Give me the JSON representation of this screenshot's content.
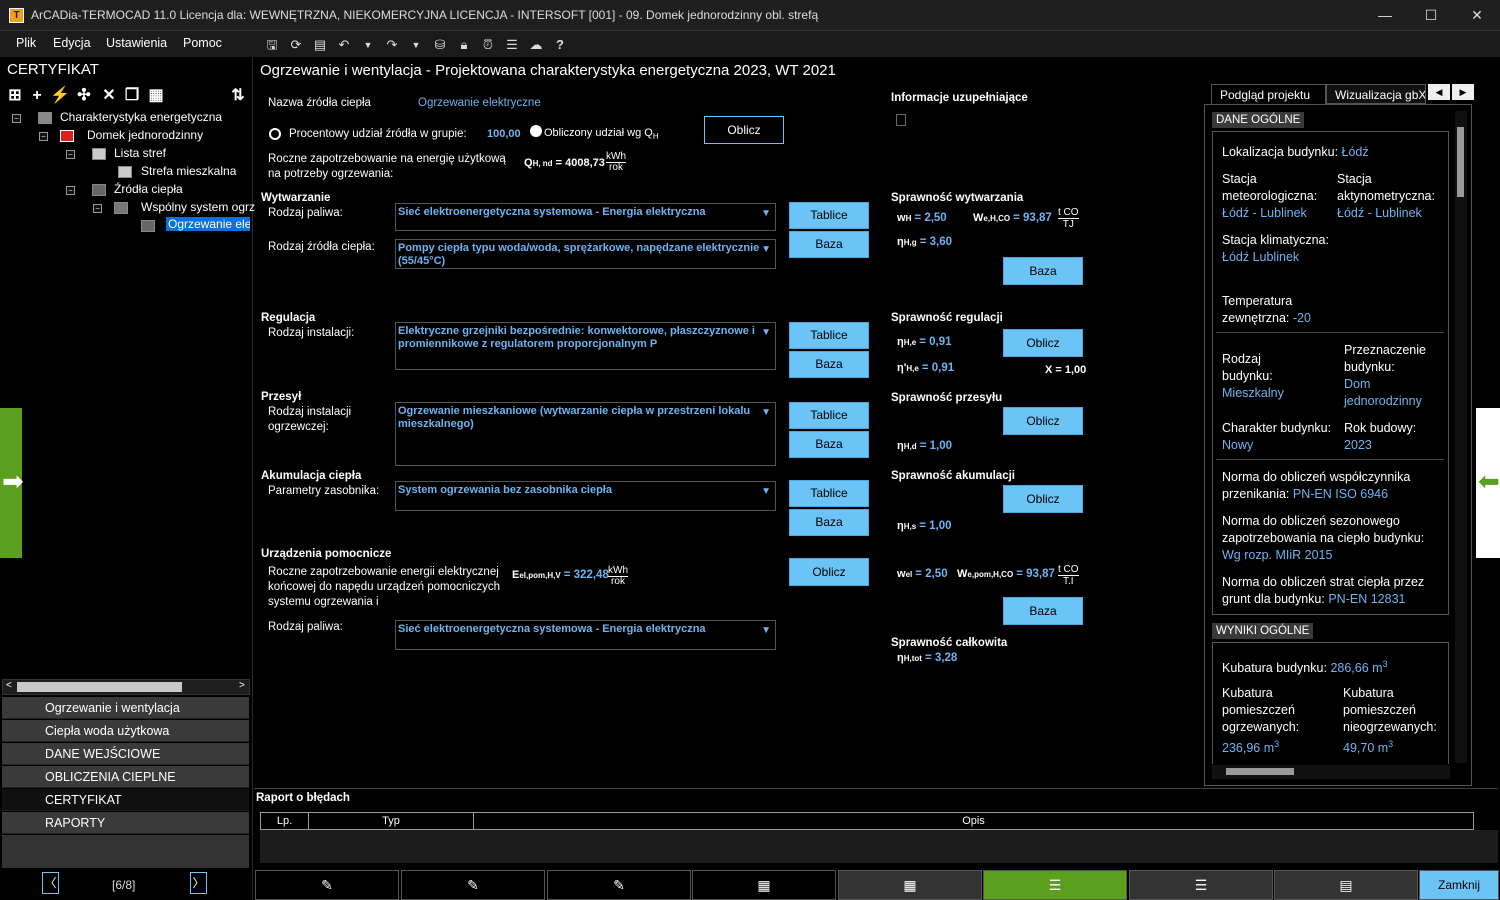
{
  "window": {
    "title": "ArCADia-TERMOCAD 11.0 Licencja dla: WEWNĘTRZNA, NIEKOMERCYJNA LICENCJA - INTERSOFT [001] - 09. Domek jednorodzinny obl. strefą",
    "app_icon": "T",
    "min": "—",
    "max": "☐",
    "close": "✕"
  },
  "menu": {
    "file": "Plik",
    "edit": "Edycja",
    "settings": "Ustawienia",
    "help": "Pomoc"
  },
  "toolbar_icons": [
    "save-icon",
    "refresh-icon",
    "preview-icon",
    "undo-icon",
    "undo-dropdown-icon",
    "redo-icon",
    "redo-dropdown-icon",
    "library-icon",
    "lock-icon",
    "alarm-icon",
    "notes-icon",
    "cloud-icon",
    "help-icon"
  ],
  "left": {
    "title": "CERTYFIKAT",
    "tree": {
      "root": "Charakterystyka energetyczna",
      "building": "Domek jednorodzinny",
      "zones": "Lista stref",
      "zone1": "Strefa mieszkalna",
      "sources": "Źródła ciepła",
      "common": "Wspólny system ogrz",
      "heating": "Ogrzewanie elektryczne"
    },
    "nav": [
      "Ogrzewanie i wentylacja",
      "Ciepła woda użytkowa",
      "DANE WEJŚCIOWE",
      "OBLICZENIA CIEPLNE",
      "CERTYFIKAT",
      "RAPORTY"
    ],
    "pager": "[6/8]",
    "prev": "〈",
    "next": "〉"
  },
  "main": {
    "heading": "Ogrzewanie i wentylacja - Projektowana charakterystyka energetyczna 2023, WT 2021",
    "source_name_label": "Nazwa źródła ciepła",
    "source_name": "Ogrzewanie elektryczne",
    "percent_label": "Procentowy udział źródła w grupie:",
    "percent_value": "100,00",
    "calc_share_label": "Obliczony udział wg Q",
    "calc_share_sub": "H",
    "calc_btn": "Oblicz",
    "annual_label": "Roczne zapotrzebowanie na energię użytkową na potrzeby ogrzewania:",
    "qhnd_label": "Q",
    "qhnd_sub": "H, nd",
    "qhnd_value": "= 4008,73",
    "unit_kwh": "kWh",
    "unit_rok": "rok",
    "info_label": "Informacje uzupełniające",
    "gen": {
      "title": "Wytwarzanie",
      "fuel_label": "Rodzaj paliwa:",
      "fuel": "Sieć elektroenergetyczna systemowa - Energia elektryczna",
      "source_label": "Rodzaj źródła ciepła:",
      "source": "Pompy ciepła typu woda/woda, sprężarkowe, napędzane elektrycznie (55/45°C)",
      "tab": "Tablice",
      "base": "Baza"
    },
    "eff_gen": {
      "title": "Sprawność wytwarzania",
      "wh": "w",
      "wh_sub": "H",
      "wh_val": "= 2,50",
      "weh": "W",
      "weh_sub": "e,H,CO",
      "weh_val": "= 93,87",
      "unit_top": "t CO",
      "unit_bot": "TJ",
      "eta": "η",
      "eta_sub": "H,g",
      "eta_val": "= 3,60",
      "base": "Baza"
    },
    "reg": {
      "title": "Regulacja",
      "inst_label": "Rodzaj instalacji:",
      "inst": "Elektryczne grzejniki bezpośrednie: konwektorowe, płaszczyznowe i promiennikowe z regulatorem proporcjonalnym P",
      "tab": "Tablice",
      "base": "Baza"
    },
    "eff_reg": {
      "title": "Sprawność regulacji",
      "eta": "η",
      "eta_sub": "H,e",
      "eta_val": "= 0,91",
      "eta2": "η'",
      "eta2_sub": "H,e",
      "eta2_val": "= 0,91",
      "x": "X = 1,00",
      "calc": "Oblicz"
    },
    "dist": {
      "title": "Przesył",
      "inst_label": "Rodzaj instalacji ogrzewczej:",
      "inst": "Ogrzewanie mieszkaniowe (wytwarzanie ciepła w przestrzeni lokalu mieszkalnego)",
      "tab": "Tablice",
      "base": "Baza"
    },
    "eff_dist": {
      "title": "Sprawność przesyłu",
      "eta": "η",
      "eta_sub": "H,d",
      "eta_val": "= 1,00",
      "calc": "Oblicz"
    },
    "acc": {
      "title": "Akumulacja ciepła",
      "param_label": "Parametry zasobnika:",
      "param": "System ogrzewania bez zasobnika ciepła",
      "tab": "Tablice",
      "base": "Baza"
    },
    "eff_acc": {
      "title": "Sprawność akumulacji",
      "eta": "η",
      "eta_sub": "H,s",
      "eta_val": "= 1,00",
      "calc": "Oblicz"
    },
    "aux": {
      "title": "Urządzenia pomocnicze",
      "desc": "Roczne zapotrzebowanie energii elektrycznej końcowej do napędu urządzeń pomocniczych systemu ogrzewania i",
      "e_label": "E",
      "e_sub": "el,pom,H,V",
      "e_val": "= 322,48",
      "calc": "Oblicz",
      "fuel_label": "Rodzaj paliwa:",
      "fuel": "Sieć elektroenergetyczna systemowa - Energia elektryczna"
    },
    "eff_aux": {
      "wel": "w",
      "wel_sub": "el",
      "wel_val": "= 2,50",
      "w2": "W",
      "w2_sub": "e,pom,H,CO",
      "w2_val": "= 93,87",
      "unit_top": "t CO",
      "unit_bot": "T.I",
      "base": "Baza"
    },
    "total": {
      "title": "Sprawność całkowita",
      "eta": "η",
      "eta_sub": "H,tot",
      "eta_val": "= 3,28"
    }
  },
  "right": {
    "tab1": "Podgląd projektu",
    "tab2": "Wizualizacja gbXML",
    "general": "DANE OGÓLNE",
    "loc_label": "Lokalizacja budynku:",
    "loc": "Łódź",
    "meteo_label": "Stacja meteorologiczna:",
    "meteo": "Łódź - Lublinek",
    "act_label": "Stacja aktynometryczna:",
    "act": "Łódź - Lublinek",
    "clim_label": "Stacja klimatyczna:",
    "clim": "Łódź Lublinek",
    "temp_label": "Temperatura zewnętrzna:",
    "temp": "-20",
    "type_label": "Rodzaj budynku:",
    "type": "Mieszkalny",
    "purpose_label": "Przeznaczenie budynku:",
    "purpose": "Dom jednorodzinny",
    "char_label": "Charakter budynku:",
    "char": "Nowy",
    "year_label": "Rok budowy:",
    "year": "2023",
    "norm1_label": "Norma do obliczeń współczynnika przenikania:",
    "norm1": "PN-EN ISO 6946",
    "norm2_label": "Norma do obliczeń sezonowego zapotrzebowania na ciepło budynku:",
    "norm2": "Wg rozp. MIiR 2015",
    "norm3_label": "Norma do obliczeń strat ciepła przez grunt dla budynku:",
    "norm3": "PN-EN 12831",
    "results": "WYNIKI OGÓLNE",
    "kub_label": "Kubatura budynku:",
    "kub": "286,66 m",
    "kub_h_label": "Kubatura pomieszczeń ogrzewanych:",
    "kub_h": "236,96 m",
    "kub_n_label": "Kubatura pomieszczeń nieogrzewanych:",
    "kub_n": "49,70 m",
    "sup": "3"
  },
  "errors": {
    "title": "Raport o błędach",
    "col_lp": "Lp.",
    "col_typ": "Typ",
    "col_opis": "Opis"
  },
  "bottom": {
    "close": "Zamknij"
  },
  "colors": {
    "accent": "#6cc3f5",
    "value": "#6fb3f0",
    "green": "#5aa01e"
  }
}
